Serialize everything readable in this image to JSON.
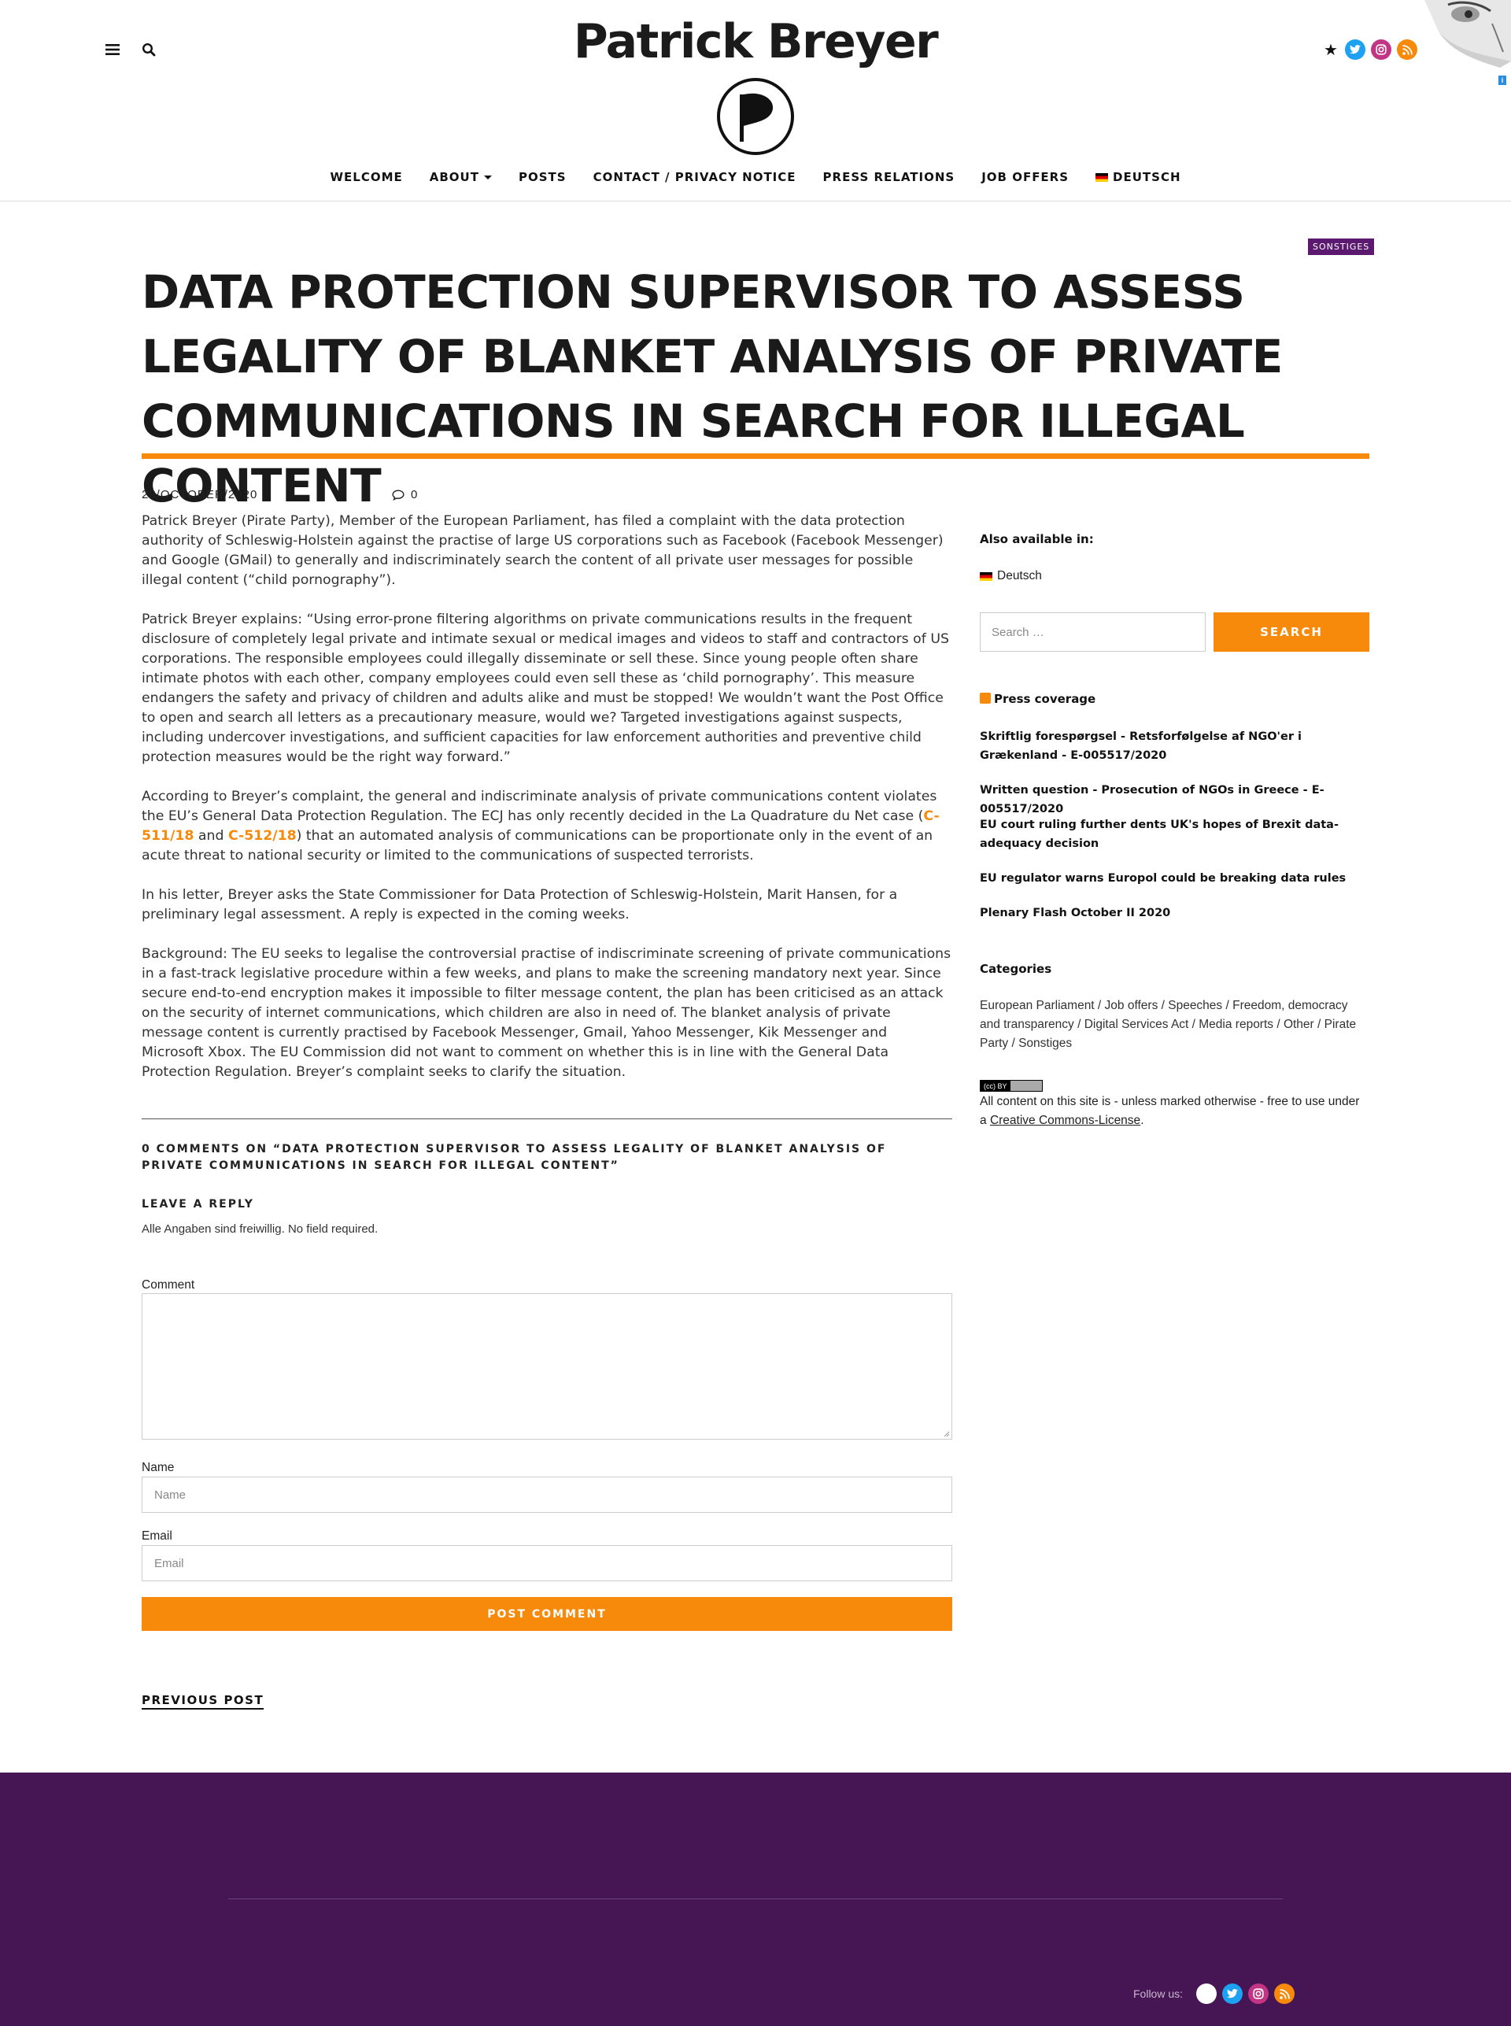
{
  "site": {
    "title": "Patrick Breyer"
  },
  "nav": {
    "items": [
      {
        "label": "WELCOME"
      },
      {
        "label": "ABOUT"
      },
      {
        "label": "POSTS"
      },
      {
        "label": "CONTACT / PRIVACY NOTICE"
      },
      {
        "label": "PRESS RELATIONS"
      },
      {
        "label": "JOB OFFERS"
      },
      {
        "label": "DEUTSCH"
      }
    ]
  },
  "icons": {
    "menu": "menu-icon",
    "search": "search-icon",
    "star": "star-icon",
    "twitter": "twitter-icon",
    "instagram": "instagram-icon",
    "rss": "rss-icon"
  },
  "colors": {
    "accent": "#f7890b",
    "category": "#5b1a70",
    "footer": "#461554",
    "twitter": "#1da1f2",
    "instagram": "#c13584"
  },
  "article": {
    "category": "SONSTIGES",
    "title": "DATA PROTECTION SUPERVISOR TO ASSESS LEGALITY OF BLANKET ANALYSIS OF PRIVATE COMMUNICATIONS IN SEARCH FOR ILLEGAL CONTENT",
    "date": "28/OCTOBER/2020",
    "comment_count": "0",
    "p1": "Patrick Breyer (Pirate Party), Member of the European Parliament, has filed a complaint with the data protection authority of Schleswig-Holstein against the practise of large US corporations such as Facebook (Facebook Messenger) and Google (GMail) to generally and indiscriminately search the content of all private user messages for possible illegal content (“child pornography”).",
    "p2": "Patrick Breyer explains: “Using error-prone filtering algorithms on private communications results in the frequent disclosure of completely legal private and intimate sexual or medical images and videos to staff and contractors of US corporations. The responsible employees could illegally disseminate or sell these. Since young people often share intimate photos with each other, company employees could even sell these as ‘child pornography’. This measure endangers the safety and privacy of children and adults alike and must be stopped! We wouldn’t want the Post Office to open and search all letters as a precautionary measure, would we? Targeted investigations against suspects, including undercover investigations, and sufficient capacities for law enforcement authorities and preventive child protection measures would be the right way forward.”",
    "p3_a": "According to Breyer’s complaint, the general and indiscriminate analysis of private communications content violates the EU’s General Data Protection Regulation. The ECJ has only recently decided in the La Quadrature du Net case (",
    "p3_link1": "C-511/18",
    "p3_b": " and ",
    "p3_link2": "C-512/18",
    "p3_c": ") that an automated analysis of communications can be proportionate only in the event of an acute threat to national security or limited to the communications of suspected terrorists.",
    "p4": "In his letter, Breyer asks the State Commissioner for Data Protection of Schleswig-Holstein, Marit Hansen, for a preliminary legal assessment. A reply is expected in the coming weeks.",
    "p5": "Background: The EU seeks to legalise the controversial practise of indiscriminate screening of private communications in a fast-track legislative procedure within a few weeks, and plans to make the screening mandatory next year. Since secure end-to-end encryption makes it impossible to filter message content, the plan has been criticised as an attack on the security of internet communications, which children are also in need of. The blanket analysis of private message content is currently practised by Facebook Messenger, Gmail, Yahoo Messenger, Kik Messenger and Microsoft Xbox. The EU Commission did not want to comment on whether this is in line with the General Data Protection Regulation. Breyer’s complaint seeks to clarify the situation."
  },
  "comments": {
    "title": "0 COMMENTS ON “DATA PROTECTION SUPERVISOR TO ASSESS LEGALITY OF BLANKET ANALYSIS OF PRIVATE COMMUNICATIONS IN SEARCH FOR ILLEGAL CONTENT”",
    "reply_title": "LEAVE A REPLY",
    "reply_note": "Alle Angaben sind freiwillig. No field required.",
    "comment_label": "Comment",
    "name_label": "Name",
    "name_placeholder": "Name",
    "email_label": "Email",
    "email_placeholder": "Email",
    "submit": "POST COMMENT",
    "previous_post": "PREVIOUS POST"
  },
  "sidebar": {
    "available_title": "Also available in:",
    "available_lang": "Deutsch",
    "search_placeholder": "Search …",
    "search_button": "SEARCH",
    "press_title": "Press coverage",
    "press_items": [
      "Skriftlig forespørgsel - Retsforfølgelse af NGO'er i Grækenland - E-005517/2020",
      "Written question - Prosecution of NGOs in Greece - E-005517/2020",
      "EU court ruling further dents UK's hopes of Brexit data-adequacy decision",
      "EU regulator warns Europol could be breaking data rules",
      "Plenary Flash October II 2020"
    ],
    "categories_title": "Categories",
    "categories": "European Parliament / Job offers / Speeches / Freedom, democracy and transparency / Digital Services Act / Media reports / Other / Pirate Party / Sonstiges",
    "license_pre": "All content on this site is - unless marked otherwise - free to use under a ",
    "license_link": "Creative Commons-License",
    "license_post": "."
  },
  "footer": {
    "follow_label": "Follow us:"
  }
}
